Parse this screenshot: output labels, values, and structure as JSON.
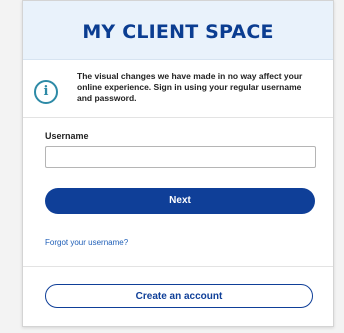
{
  "header": {
    "title": "MY CLIENT SPACE"
  },
  "notice": {
    "icon": "info-icon",
    "text": "The visual changes we have made in no way affect your online experience. Sign in using your regular username and password."
  },
  "form": {
    "username_label": "Username",
    "username_value": "",
    "username_placeholder": ""
  },
  "actions": {
    "next_label": "Next",
    "forgot_username_label": "Forgot your username?",
    "create_account_label": "Create an account"
  },
  "colors": {
    "brand_navy": "#0f3f98",
    "header_bg": "#e9f2fb",
    "info_teal": "#2d8aa6",
    "link_blue": "#1f5fb8"
  }
}
